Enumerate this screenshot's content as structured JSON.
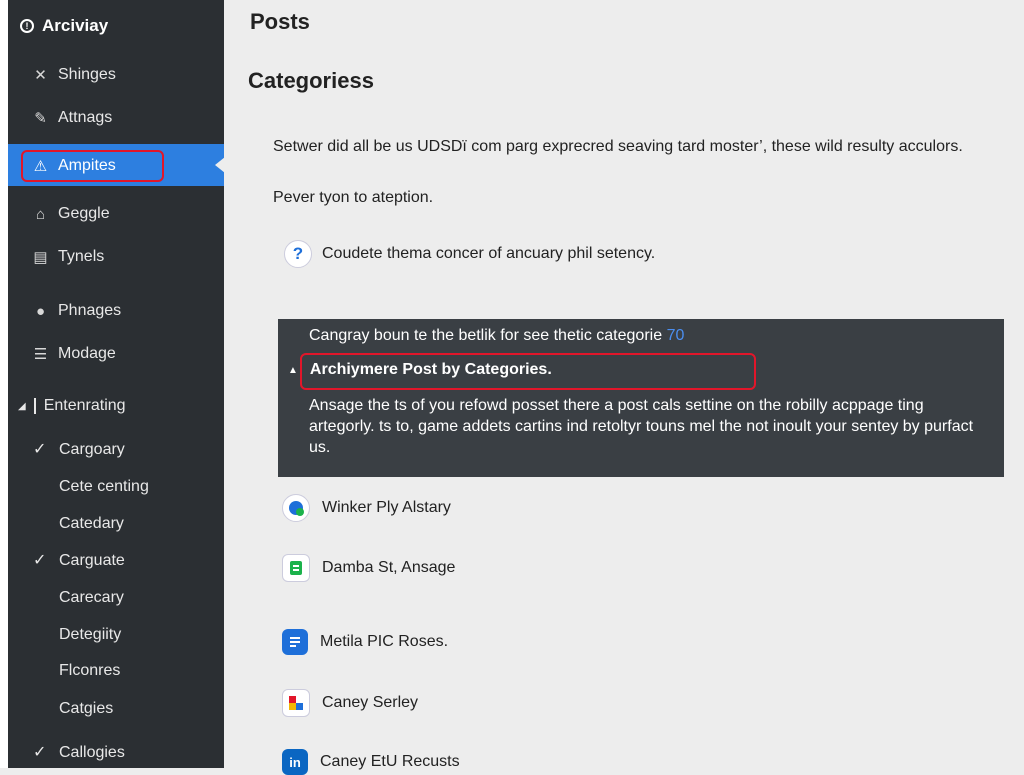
{
  "sidebar": {
    "brand": "Arciviay",
    "items": [
      {
        "label": "Shinges",
        "icon": "close-icon"
      },
      {
        "label": "Attnags",
        "icon": "pin-icon"
      },
      {
        "label": "Ampites",
        "icon": "bell-icon"
      },
      {
        "label": "Geggle",
        "icon": "home-icon"
      },
      {
        "label": "Tynels",
        "icon": "document-icon"
      },
      {
        "label": "Phnages",
        "icon": "users-icon"
      },
      {
        "label": "Modage",
        "icon": "list-icon"
      }
    ],
    "section": "Entenrating",
    "subitems": [
      {
        "label": "Cargoary",
        "checked": true
      },
      {
        "label": "Cete centing",
        "checked": false
      },
      {
        "label": "Catedary",
        "checked": false
      },
      {
        "label": "Carguate",
        "checked": true
      },
      {
        "label": "Carecary",
        "checked": false
      },
      {
        "label": "Detegiity",
        "checked": false
      },
      {
        "label": "Flconres",
        "checked": false
      },
      {
        "label": "Catgies",
        "checked": false
      },
      {
        "label": "Callogies",
        "checked": true
      }
    ]
  },
  "main": {
    "title": "Posts",
    "subtitle": "Categoriess",
    "para1": "Setwer did all be us UDSDї com parg exprecred seaving tard moster’, these wild resulty acculors.",
    "para2": "Pever tyon to ateption.",
    "help_text": "Coudete thema concer of ancuary phil setency."
  },
  "panel": {
    "top_text": "Cangray boun te the betlik for see thetic categorie",
    "top_number": "70",
    "title": "Archiymere Post by Categories.",
    "body": "Ansage the ts of you refowd posset there a post cals settine on the robilly acppage ting artegorly. ts to, game addets cartins ind retoltyr touns mel the not inoult your sentey by purfact us."
  },
  "list": [
    {
      "label": "Winker Ply Alstary",
      "icon": "globe-icon"
    },
    {
      "label": "Damba St, Ansage",
      "icon": "clipboard-icon"
    },
    {
      "label": "Metila PIC Roses.",
      "icon": "document-icon"
    },
    {
      "label": "Caney Serley",
      "icon": "app-icon"
    },
    {
      "label": "Caney EtU Recusts",
      "icon": "linkedin-icon"
    }
  ],
  "colors": {
    "sidebar_bg": "#2b2f33",
    "active_bg": "#2d7fe0",
    "highlight_outline": "#e2162a",
    "panel_bg": "#3a3f44"
  }
}
